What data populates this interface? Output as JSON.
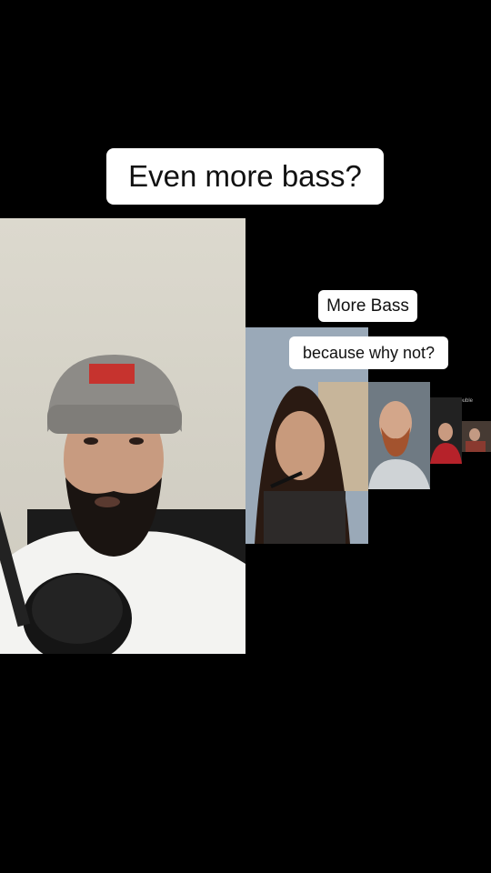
{
  "captions": {
    "main": "Even more bass?",
    "more_bass": "More Bass",
    "because_why_not": "because why not?"
  },
  "nested_videos": {
    "mini_label": "Bass Double"
  },
  "colors": {
    "background": "#000000",
    "caption_bg": "#ffffff",
    "caption_text": "#111111"
  }
}
